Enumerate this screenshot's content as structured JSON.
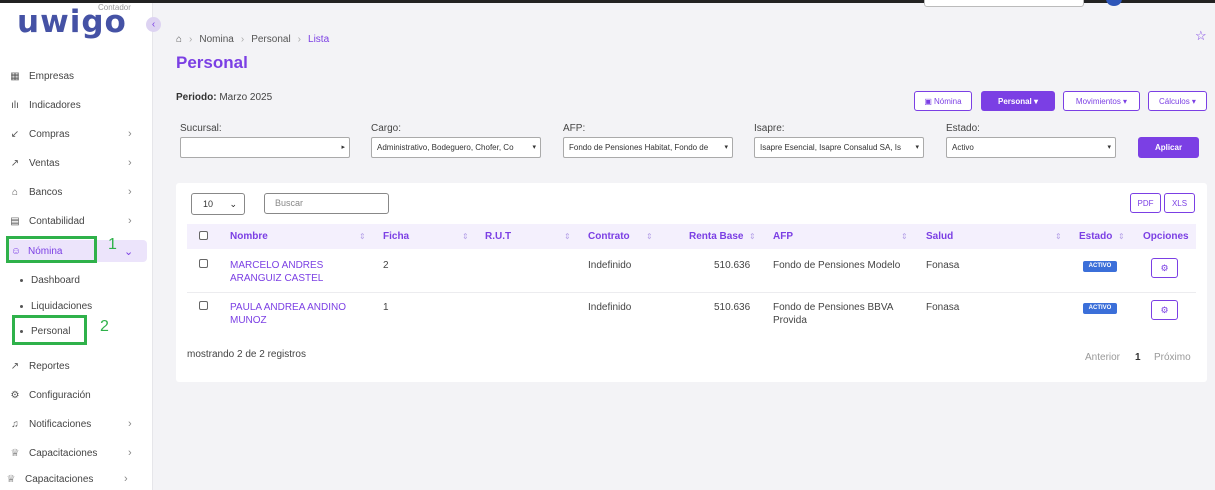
{
  "brand": {
    "logo": "uwigo",
    "sub": "Contador"
  },
  "colors": {
    "accent": "#7b3fe4",
    "badge": "#3b6fd9",
    "highlight": "#2fb14a"
  },
  "sidebar": {
    "items": [
      {
        "label": "Empresas",
        "icon": "building-icon"
      },
      {
        "label": "Indicadores",
        "icon": "bar-chart-icon"
      },
      {
        "label": "Compras",
        "icon": "arrow-down-left-icon"
      },
      {
        "label": "Ventas",
        "icon": "arrow-up-right-icon"
      },
      {
        "label": "Bancos",
        "icon": "bank-icon"
      },
      {
        "label": "Contabilidad",
        "icon": "calculator-icon"
      },
      {
        "label": "Nómina",
        "icon": "users-icon"
      },
      {
        "label": "Reportes",
        "icon": "line-chart-icon"
      },
      {
        "label": "Configuración",
        "icon": "gear-icon"
      },
      {
        "label": "Notificaciones",
        "icon": "bell-icon"
      },
      {
        "label": "Capacitaciones",
        "icon": "graduation-cap-icon"
      },
      {
        "label": "Capacitaciones",
        "icon": "graduation-cap-icon"
      }
    ],
    "subitems": [
      "Dashboard",
      "Liquidaciones",
      "Personal"
    ],
    "annotations": [
      "1",
      "2"
    ]
  },
  "breadcrumb": [
    "Nomina",
    "Personal",
    "Lista"
  ],
  "page": {
    "title": "Personal",
    "periodo_label": "Periodo:",
    "periodo_value": "Marzo 2025"
  },
  "actions": {
    "nomina": "Nómina",
    "personal": "Personal ▾",
    "movimientos": "Movimientos ▾",
    "calculos": "Cálculos ▾"
  },
  "filters": {
    "sucursal": {
      "label": "Sucursal:",
      "value": ""
    },
    "cargo": {
      "label": "Cargo:",
      "value": "Administrativo, Bodeguero, Chofer, Co"
    },
    "afp": {
      "label": "AFP:",
      "value": "Fondo de Pensiones Habitat, Fondo de"
    },
    "isapre": {
      "label": "Isapre:",
      "value": "Isapre Esencial, Isapre Consalud SA, Is"
    },
    "estado": {
      "label": "Estado:",
      "value": "Activo"
    },
    "apply": "Aplicar"
  },
  "table": {
    "page_length": "10",
    "search_placeholder": "Buscar",
    "export": [
      "PDF",
      "XLS"
    ],
    "columns": [
      "Nombre",
      "Ficha",
      "R.U.T",
      "Contrato",
      "Renta Base",
      "AFP",
      "Salud",
      "Estado",
      "Opciones"
    ],
    "rows": [
      {
        "nombre": "MARCELO ANDRES ARANGUIZ CASTEL",
        "ficha": "2",
        "rut": "",
        "contrato": "Indefinido",
        "renta": "510.636",
        "afp": "Fondo de Pensiones Modelo",
        "salud": "Fonasa",
        "estado": "ACTIVO"
      },
      {
        "nombre": "PAULA ANDREA ANDINO MUNOZ",
        "ficha": "1",
        "rut": "",
        "contrato": "Indefinido",
        "renta": "510.636",
        "afp": "Fondo de Pensiones BBVA Provida",
        "salud": "Fonasa",
        "estado": "ACTIVO"
      }
    ],
    "info": "mostrando 2 de 2 registros",
    "pager": {
      "prev": "Anterior",
      "current": "1",
      "next": "Próximo"
    }
  }
}
